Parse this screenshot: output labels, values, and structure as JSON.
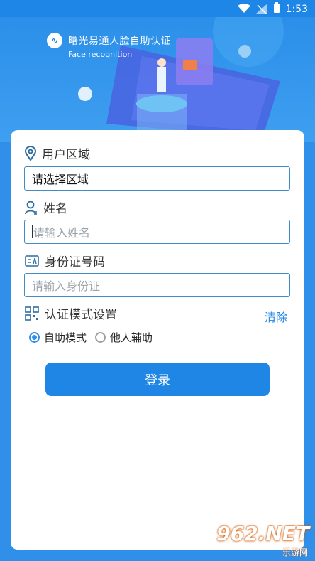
{
  "status_bar": {
    "time": "1:53"
  },
  "brand": {
    "logo_text": "∿",
    "title": "曙光易通人脸自助认证",
    "subtitle": "Face recognition"
  },
  "form": {
    "region_label": "用户区域",
    "region_value": "请选择区域",
    "name_label": "姓名",
    "name_placeholder": "请输入姓名",
    "id_label": "身份证号码",
    "id_placeholder": "请输入身份证",
    "auth_mode_label": "认证模式设置",
    "clear_label": "清除",
    "mode_options": [
      "自助模式",
      "他人辅助"
    ],
    "selected_mode": "自助模式",
    "login_label": "登录"
  },
  "watermark": {
    "main": "962.NET",
    "sub": "乐游网"
  }
}
